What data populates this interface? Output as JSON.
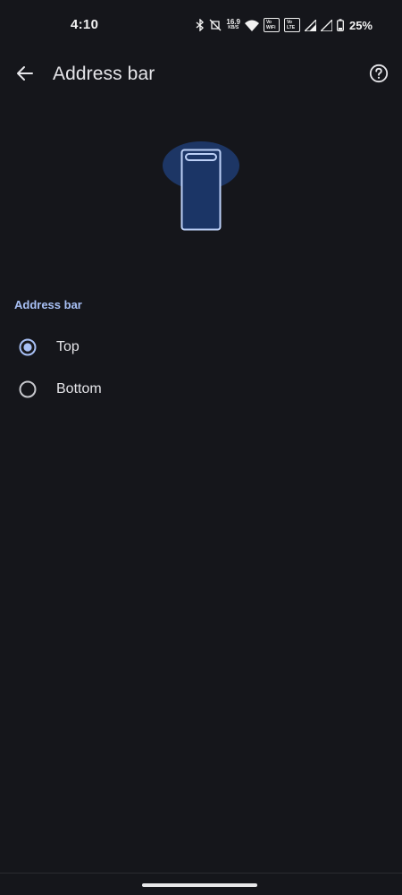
{
  "status_bar": {
    "time": "4:10",
    "net_speed_value": "16.9",
    "net_speed_unit": "KB/S",
    "vowifi_label_top": "Vo",
    "vowifi_label_bottom": "WiFi",
    "volte_label_top": "Vo",
    "volte_label_bottom": "LTE",
    "battery_percent": "25%"
  },
  "app_bar": {
    "title": "Address bar",
    "back_icon": "arrow-back-icon",
    "help_icon": "help-circle-icon"
  },
  "illustration": {
    "icon": "phone-address-bar-illustration",
    "colors": {
      "blob": "#1d3665",
      "phone_fill": "#1b3566",
      "outline": "#bcd0f7"
    }
  },
  "settings": {
    "section_title": "Address bar",
    "options": [
      {
        "label": "Top",
        "selected": true
      },
      {
        "label": "Bottom",
        "selected": false
      }
    ]
  },
  "colors": {
    "background": "#15161b",
    "accent": "#a8c0f5"
  }
}
